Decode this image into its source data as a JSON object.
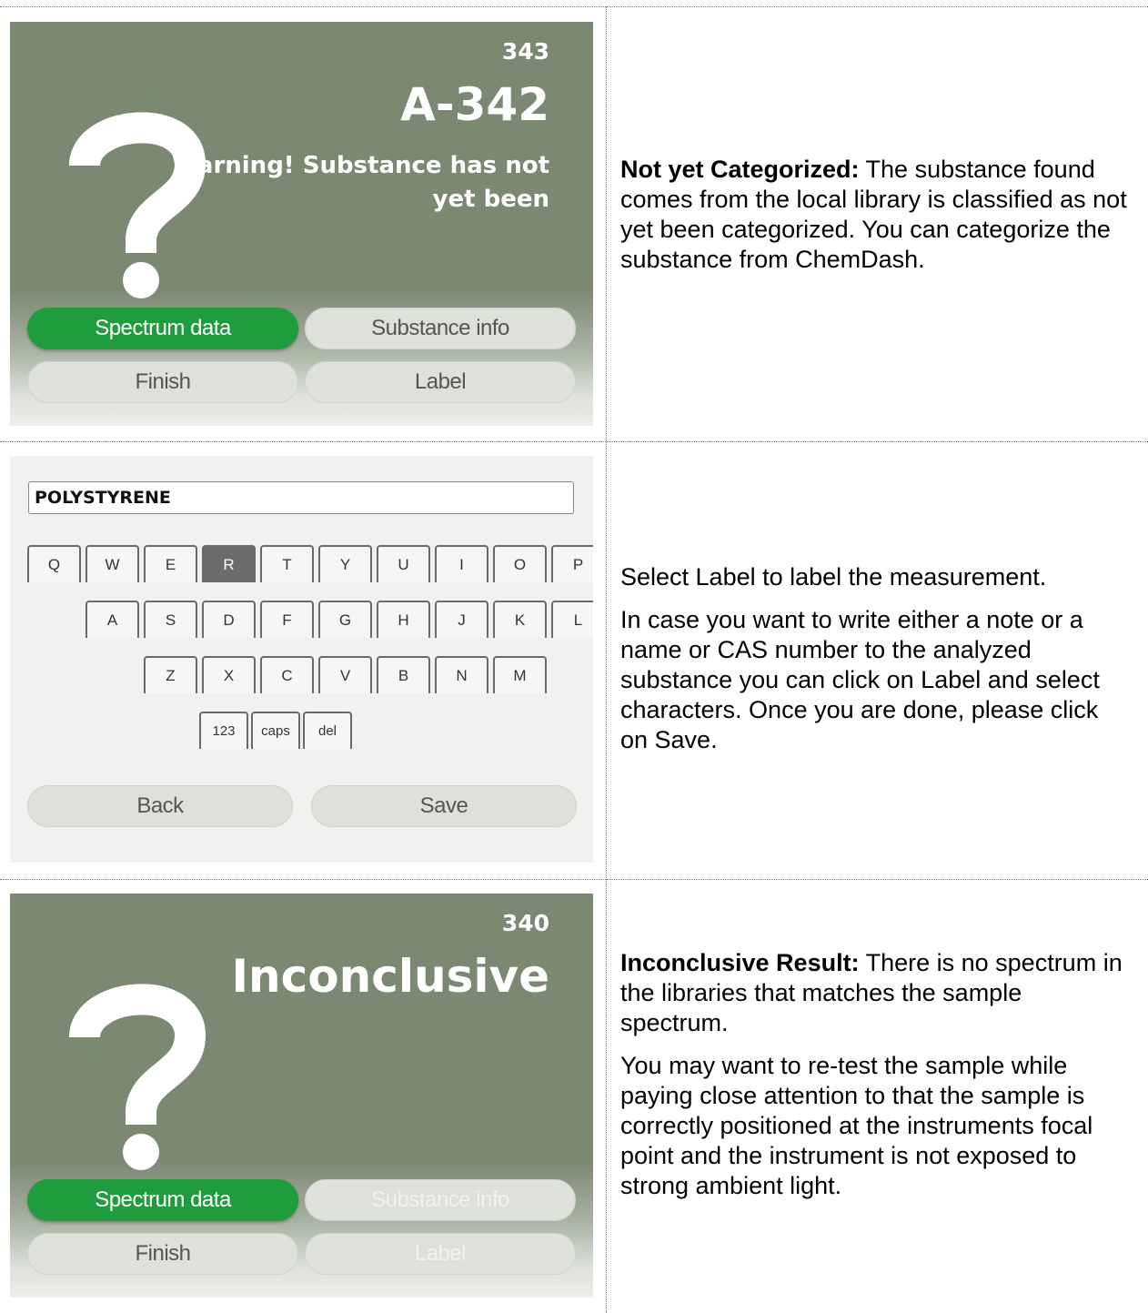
{
  "panel1": {
    "screen": {
      "code_number": "343",
      "title": "A-342",
      "warning": "Warning! Substance has not yet been",
      "buttons": {
        "spectrum_data": "Spectrum data",
        "substance_info": "Substance info",
        "finish": "Finish",
        "label": "Label"
      }
    },
    "desc_bold": "Not yet Categorized:",
    "desc": " The substance found comes from the local library is classified as not yet been categorized. You can categorize the substance from ChemDash."
  },
  "panel2": {
    "screen": {
      "field_value": "POLYSTYRENE",
      "row1": [
        "Q",
        "W",
        "E",
        "R",
        "T",
        "Y",
        "U",
        "I",
        "O",
        "P"
      ],
      "row2": [
        "A",
        "S",
        "D",
        "F",
        "G",
        "H",
        "J",
        "K",
        "L"
      ],
      "row3": [
        "Z",
        "X",
        "C",
        "V",
        "B",
        "N",
        "M"
      ],
      "row4": [
        "123",
        "caps",
        "del"
      ],
      "active_key": "R",
      "buttons": {
        "back": "Back",
        "save": "Save"
      }
    },
    "para1": "Select Label to label the measurement.",
    "para2": "In case you want to write either a note or a name or CAS number to the analyzed substance you can click on Label and select characters. Once you are done, please click on Save."
  },
  "panel3": {
    "screen": {
      "code_number": "340",
      "title": "Inconclusive",
      "buttons": {
        "spectrum_data": "Spectrum data",
        "substance_info": "Substance info",
        "finish": "Finish",
        "label": "Label"
      }
    },
    "desc_bold": "Inconclusive Result:",
    "desc": " There is no spectrum in the libraries that matches the sample spectrum.",
    "para2": "You may want to re-test the sample while paying close attention to that the sample is correctly positioned at the instruments focal point and the instrument is not exposed to strong ambient light."
  },
  "colors": {
    "screen_bg": "#7b8872",
    "active_green": "#1f9c3c",
    "key_active": "#6b6b6b"
  },
  "icons": {
    "result_icon": "question-mark-icon"
  }
}
